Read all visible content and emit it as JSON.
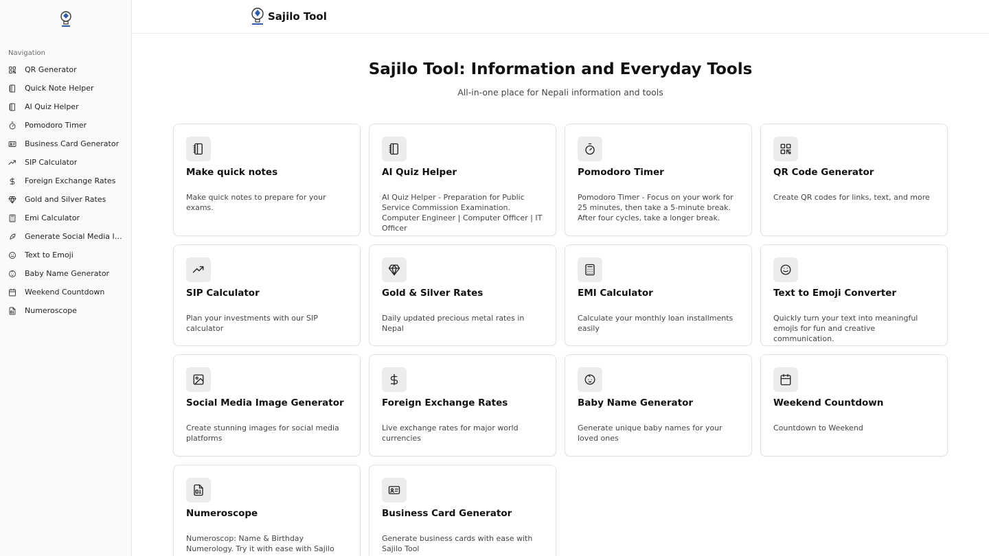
{
  "brand": {
    "name": "Sajilo Tool"
  },
  "sidebar": {
    "nav_title": "Navigation",
    "items": [
      {
        "label": "QR Generator",
        "icon": "qr-icon"
      },
      {
        "label": "Quick Note Helper",
        "icon": "notebook-icon"
      },
      {
        "label": "AI Quiz Helper",
        "icon": "notebook-icon"
      },
      {
        "label": "Pomodoro Timer",
        "icon": "timer-icon"
      },
      {
        "label": "Business Card Generator",
        "icon": "id-card-icon"
      },
      {
        "label": "SIP Calculator",
        "icon": "trending-up-icon"
      },
      {
        "label": "Foreign Exchange Rates",
        "icon": "dollar-icon"
      },
      {
        "label": "Gold and Silver Rates",
        "icon": "gem-icon"
      },
      {
        "label": "Emi Calculator",
        "icon": "calculator-icon"
      },
      {
        "label": "Generate Social Media Images",
        "icon": "feather-icon"
      },
      {
        "label": "Text to Emoji",
        "icon": "smile-icon"
      },
      {
        "label": "Baby Name Generator",
        "icon": "baby-icon"
      },
      {
        "label": "Weekend Countdown",
        "icon": "calendar-icon"
      },
      {
        "label": "Numeroscope",
        "icon": "file-digit-icon"
      }
    ]
  },
  "hero": {
    "title": "Sajilo Tool: Information and Everyday Tools",
    "subtitle": "All-in-one place for Nepali information and tools"
  },
  "cards": [
    {
      "title": "Make quick notes",
      "desc": "Make quick notes to prepare for your exams.",
      "icon": "notebook-icon"
    },
    {
      "title": "AI Quiz Helper",
      "desc": "AI Quiz Helper - Preparation for Public Service Commission Examination. Computer Engineer | Computer Officer | IT Officer",
      "icon": "notebook-icon"
    },
    {
      "title": "Pomodoro Timer",
      "desc": "Pomodoro Timer - Focus on your work for 25 minutes, then take a 5-minute break. After four cycles, take a longer break.",
      "icon": "timer-icon"
    },
    {
      "title": "QR Code Generator",
      "desc": "Create QR codes for links, text, and more",
      "icon": "qr-icon"
    },
    {
      "title": "SIP Calculator",
      "desc": "Plan your investments with our SIP calculator",
      "icon": "trending-up-icon"
    },
    {
      "title": "Gold & Silver Rates",
      "desc": "Daily updated precious metal rates in Nepal",
      "icon": "gem-icon"
    },
    {
      "title": "EMI Calculator",
      "desc": "Calculate your monthly loan installments easily",
      "icon": "calculator-icon"
    },
    {
      "title": "Text to Emoji Converter",
      "desc": "Quickly turn your text into meaningful emojis for fun and creative communication.",
      "icon": "smile-icon"
    },
    {
      "title": "Social Media Image Generator",
      "desc": "Create stunning images for social media platforms",
      "icon": "image-icon"
    },
    {
      "title": "Foreign Exchange Rates",
      "desc": "Live exchange rates for major world currencies",
      "icon": "dollar-icon"
    },
    {
      "title": "Baby Name Generator",
      "desc": "Generate unique baby names for your loved ones",
      "icon": "baby-icon"
    },
    {
      "title": "Weekend Countdown",
      "desc": "Countdown to Weekend",
      "icon": "calendar-icon"
    },
    {
      "title": "Numeroscope",
      "desc": "Numeroscop: Name & Birthday Numerology. Try it with ease with Sajilo Tool",
      "icon": "file-digit-icon"
    },
    {
      "title": "Business Card Generator",
      "desc": "Generate business cards with ease with Sajilo Tool",
      "icon": "id-card-icon"
    }
  ]
}
